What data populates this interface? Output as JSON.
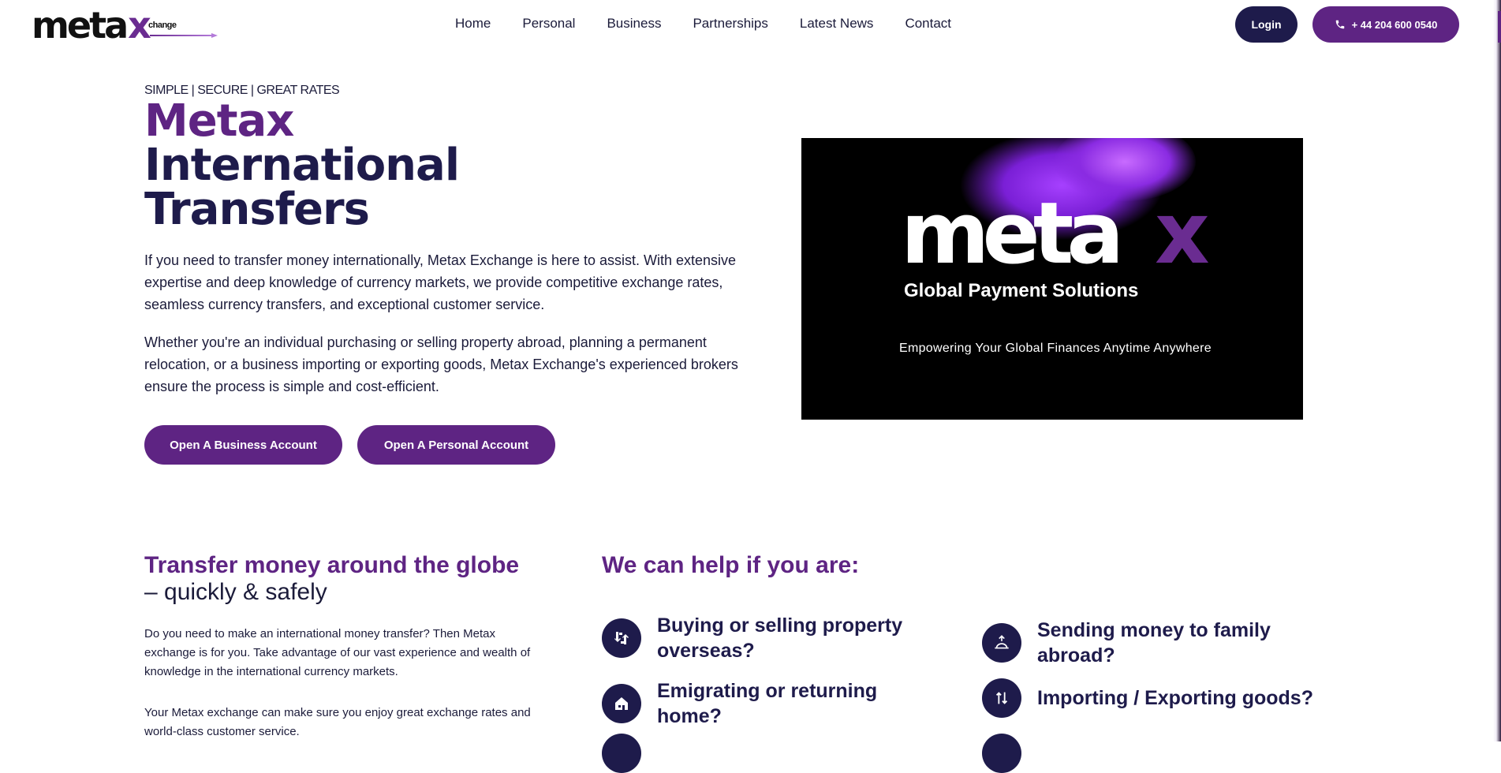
{
  "header": {
    "logo_main": "meta",
    "logo_x": "x",
    "logo_sub": "change",
    "nav": [
      "Home",
      "Personal",
      "Business",
      "Partnerships",
      "Latest News",
      "Contact"
    ],
    "login_label": "Login",
    "phone_label": "+ 44 204 600 0540",
    "icons": {
      "phone": "phone-icon"
    }
  },
  "hero": {
    "tagline": "SIMPLE | SECURE | GREAT RATES",
    "title_line1": "Metax",
    "title_line2": "International",
    "title_line3": "Transfers",
    "paragraph1": "If you need to transfer money internationally, Metax Exchange is here to assist. With extensive expertise and deep knowledge of currency markets, we provide competitive exchange rates, seamless currency transfers, and exceptional customer service.",
    "paragraph2": "Whether you're an individual purchasing or selling property abroad, planning a permanent relocation, or a business importing or exporting goods, Metax Exchange's experienced brokers ensure the process is simple and cost-efficient.",
    "btn_business": "Open A Business Account",
    "btn_personal": "Open A Personal Account"
  },
  "video": {
    "brand": "meta",
    "brand_x": "x",
    "subtitle": "Global Payment Solutions",
    "slogan": "Empowering Your Global Finances Anytime Anywhere"
  },
  "transfer": {
    "title": "Transfer money around the globe",
    "subtitle": "– quickly & safely",
    "paragraph1": "Do you need to make an international money transfer? Then Metax exchange is for you. Take advantage of our vast experience and wealth of knowledge in the international currency markets.",
    "paragraph2": "Your Metax exchange can make sure you enjoy great exchange rates and world-class customer service."
  },
  "help": {
    "title": "We can help if you are:",
    "items": [
      {
        "label": "Buying or selling property overseas?",
        "icon": "property-exchange-icon"
      },
      {
        "label": "Sending money to family abroad?",
        "icon": "money-send-icon"
      },
      {
        "label": "Emigrating or returning home?",
        "icon": "home-icon"
      },
      {
        "label": "Importing / Exporting goods?",
        "icon": "import-export-icon"
      }
    ]
  },
  "colors": {
    "brand_purple": "#5e2483",
    "navy": "#1e1b4b",
    "text": "#1b1b3a"
  }
}
